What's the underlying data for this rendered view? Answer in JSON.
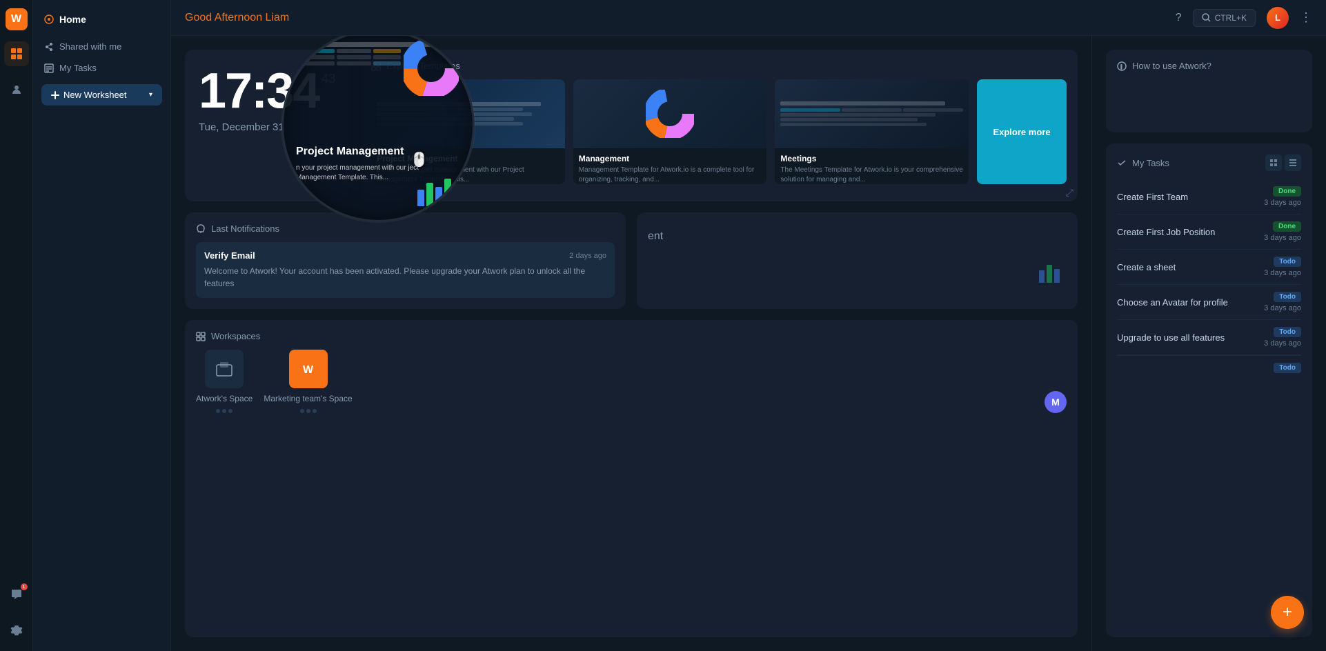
{
  "app": {
    "logo": "W",
    "title": "Home"
  },
  "topbar": {
    "greeting": "Good Afternoon",
    "user_name": "Liam",
    "search_label": "CTRL+K",
    "help_icon": "?",
    "avatar_initials": "L"
  },
  "sidebar": {
    "items": [
      {
        "label": "Shared with me",
        "icon": "▶"
      },
      {
        "label": "My Tasks",
        "icon": "≡"
      }
    ],
    "new_worksheet_label": "New Worksheet"
  },
  "clock": {
    "time": "17:34",
    "seconds": "43",
    "date": "Tue, December 31"
  },
  "explore_templates": {
    "header": "Explore Templates",
    "cards": [
      {
        "title": "Project Management",
        "desc": "Boost your project management with our Project Management Template. This..."
      },
      {
        "title": "Management",
        "desc": "Management Template for Atwork.io is a complete tool for organizing, tracking, and..."
      },
      {
        "title": "Meetings",
        "desc": "The Meetings Template for Atwork.io is your comprehensive solution for managing and..."
      }
    ],
    "explore_more_label": "Explore more"
  },
  "notifications": {
    "header": "Last Notifications",
    "items": [
      {
        "title": "Verify Email",
        "time": "2 days ago",
        "body": "Welcome to Atwork! Your account has been activated. Please upgrade your Atwork plan to unlock all the features"
      }
    ]
  },
  "workspaces": {
    "header": "Workspaces",
    "items": [
      {
        "name": "Atwork's Space",
        "icon": "🏢"
      },
      {
        "name": "Marketing team's Space",
        "icon": "W"
      }
    ]
  },
  "how_to": {
    "header": "How to use Atwork?"
  },
  "my_tasks": {
    "header": "My Tasks",
    "tasks": [
      {
        "name": "Create First Team",
        "status": "Done",
        "time": "3 days ago"
      },
      {
        "name": "Create First Job Position",
        "status": "Done",
        "time": "3 days ago"
      },
      {
        "name": "Create a sheet",
        "status": "Todo",
        "time": "3 days ago"
      },
      {
        "name": "Choose an Avatar for profile",
        "status": "Todo",
        "time": "3 days ago"
      },
      {
        "name": "Upgrade to use all features",
        "status": "Todo",
        "time": "3 days ago"
      }
    ]
  },
  "fab": {
    "label": "+"
  },
  "icons": {
    "grid": "⊞",
    "list": "≡",
    "share": "▷",
    "bell": "🔔",
    "chat": "💬",
    "settings": "⚙",
    "person": "👤",
    "workspace": "⊡",
    "template": "📋",
    "info": "ℹ",
    "tasks": "✓",
    "chevron": "▾",
    "dots": "⋮",
    "search": "🔍"
  }
}
